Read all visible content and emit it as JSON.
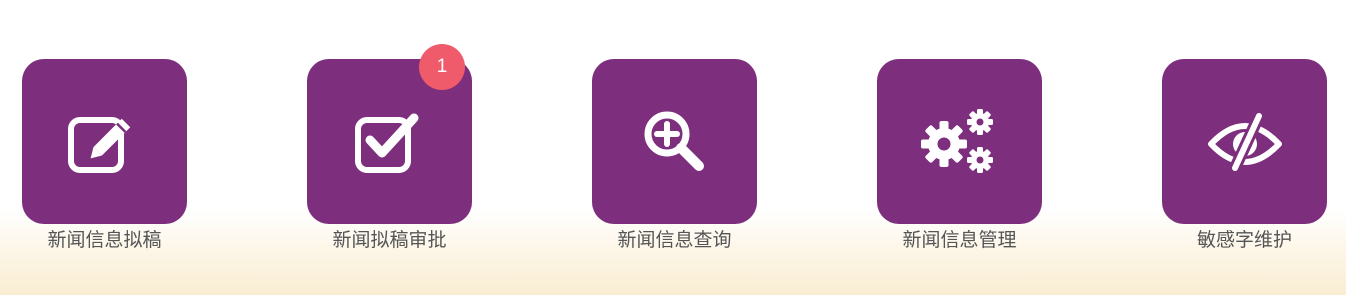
{
  "theme": {
    "tile_color": "#7d2e7d",
    "badge_color": "#ef5b6a",
    "label_color": "#555555"
  },
  "tiles": [
    {
      "label": "新闻信息拟稿",
      "icon": "edit-pencil-icon"
    },
    {
      "label": "新闻拟稿审批",
      "icon": "checkbox-check-icon",
      "badge": "1"
    },
    {
      "label": "新闻信息查询",
      "icon": "search-plus-icon"
    },
    {
      "label": "新闻信息管理",
      "icon": "gears-icon"
    },
    {
      "label": "敏感字维护",
      "icon": "eye-slash-icon"
    }
  ]
}
